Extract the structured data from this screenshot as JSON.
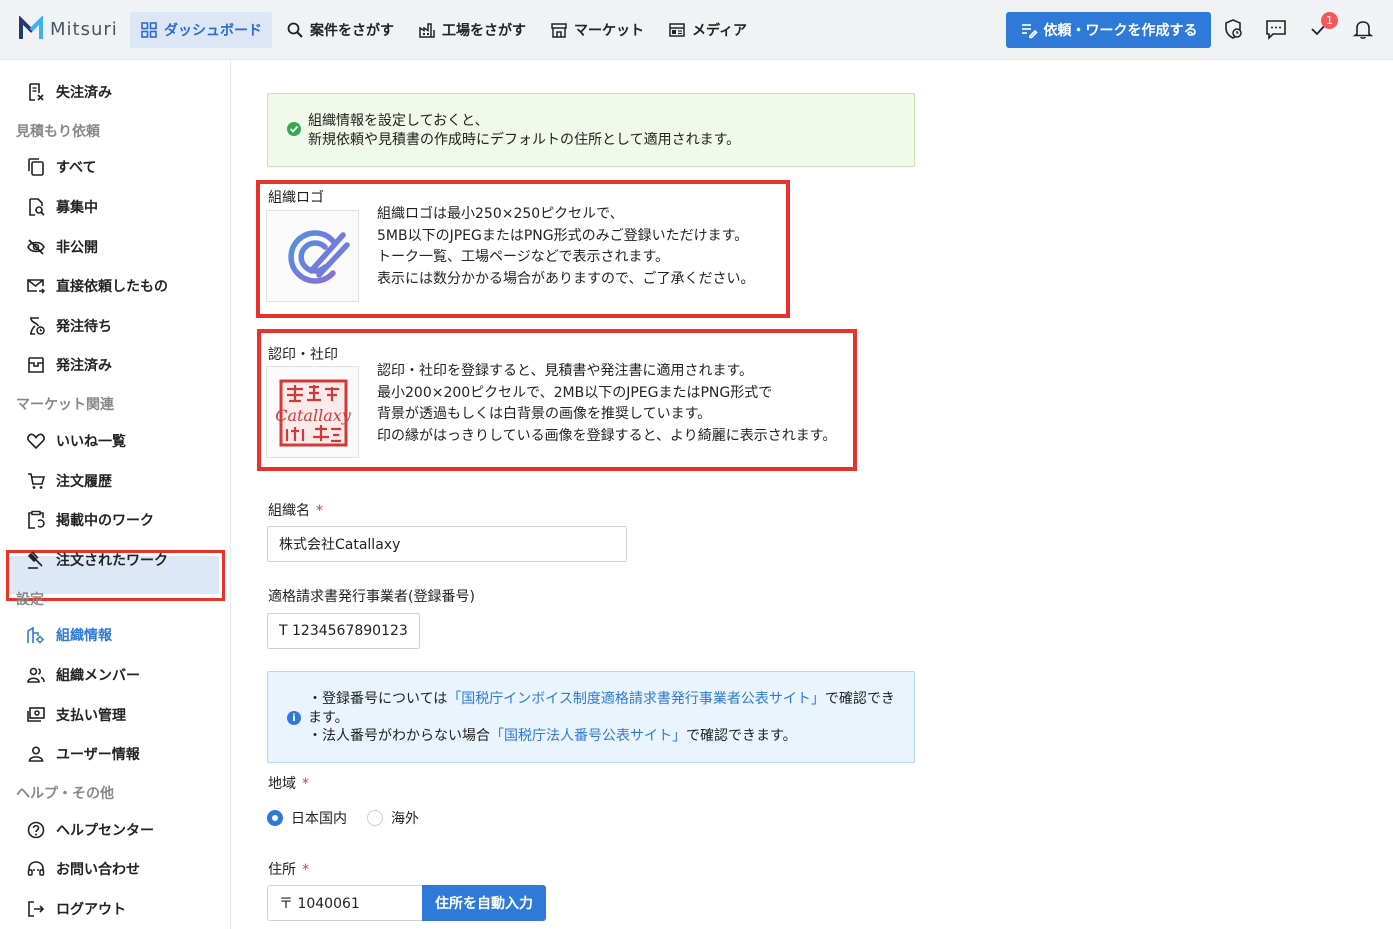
{
  "header": {
    "logo_text": "Mitsuri",
    "nav": [
      {
        "label": "ダッシュボード",
        "icon": "grid-icon",
        "active": true
      },
      {
        "label": "案件をさがす",
        "icon": "search-icon"
      },
      {
        "label": "工場をさがす",
        "icon": "factory-icon"
      },
      {
        "label": "マーケット",
        "icon": "store-icon"
      },
      {
        "label": "メディア",
        "icon": "newspaper-icon"
      }
    ],
    "create_button": "依頼・ワークを作成する",
    "badge_count": "1",
    "accent_color": "#2f7ad8"
  },
  "sidebar": {
    "top_item": "失注済み",
    "sections": [
      {
        "title": "見積もり依頼",
        "items": [
          "すべて",
          "募集中",
          "非公開",
          "直接依頼したもの",
          "発注待ち",
          "発注済み"
        ]
      },
      {
        "title": "マーケット関連",
        "items": [
          "いいね一覧",
          "注文履歴",
          "掲載中のワーク",
          "注文されたワーク"
        ]
      },
      {
        "title": "設定",
        "items": [
          "組織情報",
          "組織メンバー",
          "支払い管理",
          "ユーザー情報"
        ]
      },
      {
        "title": "ヘルプ・その他",
        "items": [
          "ヘルプセンター",
          "お問い合わせ",
          "ログアウト"
        ]
      }
    ]
  },
  "main": {
    "notice": [
      "組織情報を設定しておくと、",
      "新規依頼や見積書の作成時にデフォルトの住所として適用されます。"
    ],
    "logo_section": {
      "label": "組織ロゴ",
      "desc": [
        "組織ロゴは最小250×250ピクセルで、",
        "5MB以下のJPEGまたはPNG形式のみご登録いただけます。",
        "トーク一覧、工場ページなどで表示されます。",
        "表示には数分かかる場合がありますので、ご了承ください。"
      ]
    },
    "seal_section": {
      "label": "認印・社印",
      "seal_text": "Catallaxy",
      "desc": [
        "認印・社印を登録すると、見積書や発注書に適用されます。",
        "最小200×200ピクセルで、2MB以下のJPEGまたはPNG形式で",
        "背景が透過もしくは白背景の画像を推奨しています。",
        "印の縁がはっきりしている画像を登録すると、より綺麗に表示されます。"
      ]
    },
    "org_name": {
      "label": "組織名",
      "required": "*",
      "value": "株式会社Catallaxy"
    },
    "invoice": {
      "label": "適格請求書発行事業者(登録番号)",
      "value": "T 1234567890123"
    },
    "info": {
      "line1_pre": "・登録番号については",
      "line1_link": "「国税庁インボイス制度適格請求書発行事業者公表サイト」",
      "line1_post": "で確認できます。",
      "line2_pre": "・法人番号がわからない場合",
      "line2_link": "「国税庁法人番号公表サイト」",
      "line2_post": "で確認できます。"
    },
    "region": {
      "label": "地域",
      "required": "*",
      "options": [
        "日本国内",
        "海外"
      ],
      "selected": "日本国内"
    },
    "address": {
      "label": "住所",
      "required": "*",
      "postal": "〒 1040061",
      "auto_button": "住所を自動入力"
    }
  }
}
